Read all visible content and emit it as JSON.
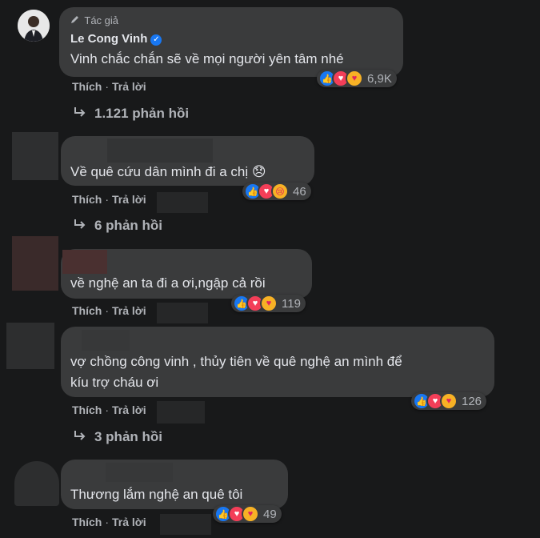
{
  "comments": [
    {
      "author_badge": "Tác giả",
      "author_name": "Le Cong Vinh",
      "text": "Vinh chắc chắn sẽ về mọi người yên tâm nhé",
      "like_label": "Thích",
      "reply_label": "Trả lời",
      "reaction_count": "6,9K",
      "replies_label": "1.121 phản hồi"
    },
    {
      "text": "Về quê cứu dân mình đi a chị 😞",
      "like_label": "Thích",
      "reply_label": "Trả lời",
      "reaction_count": "46",
      "replies_label": "6 phản hồi"
    },
    {
      "text": "về nghệ an ta đi a ơi,ngập cả rồi",
      "like_label": "Thích",
      "reply_label": "Trả lời",
      "reaction_count": "119"
    },
    {
      "text_line1": "vợ chồng công vinh , thủy tiên về quê nghệ an mình để",
      "text_line2": "kíu trợ cháu ơi",
      "like_label": "Thích",
      "reply_label": "Trả lời",
      "reaction_count": "126",
      "replies_label": "3 phản hồi"
    },
    {
      "text": "Thương lắm nghệ an quê tôi",
      "like_label": "Thích",
      "reply_label": "Trả lời",
      "reaction_count": "49"
    }
  ],
  "reaction_icons": [
    "like-icon",
    "love-icon",
    "care-icon"
  ],
  "separator": "·",
  "colors": {
    "background": "#18191a",
    "bubble": "#3a3b3c",
    "text": "#e4e6eb",
    "secondary_text": "#b0b3b8",
    "like_blue": "#1877f2",
    "love_red": "#f33e58",
    "care_yellow": "#f7b125"
  }
}
